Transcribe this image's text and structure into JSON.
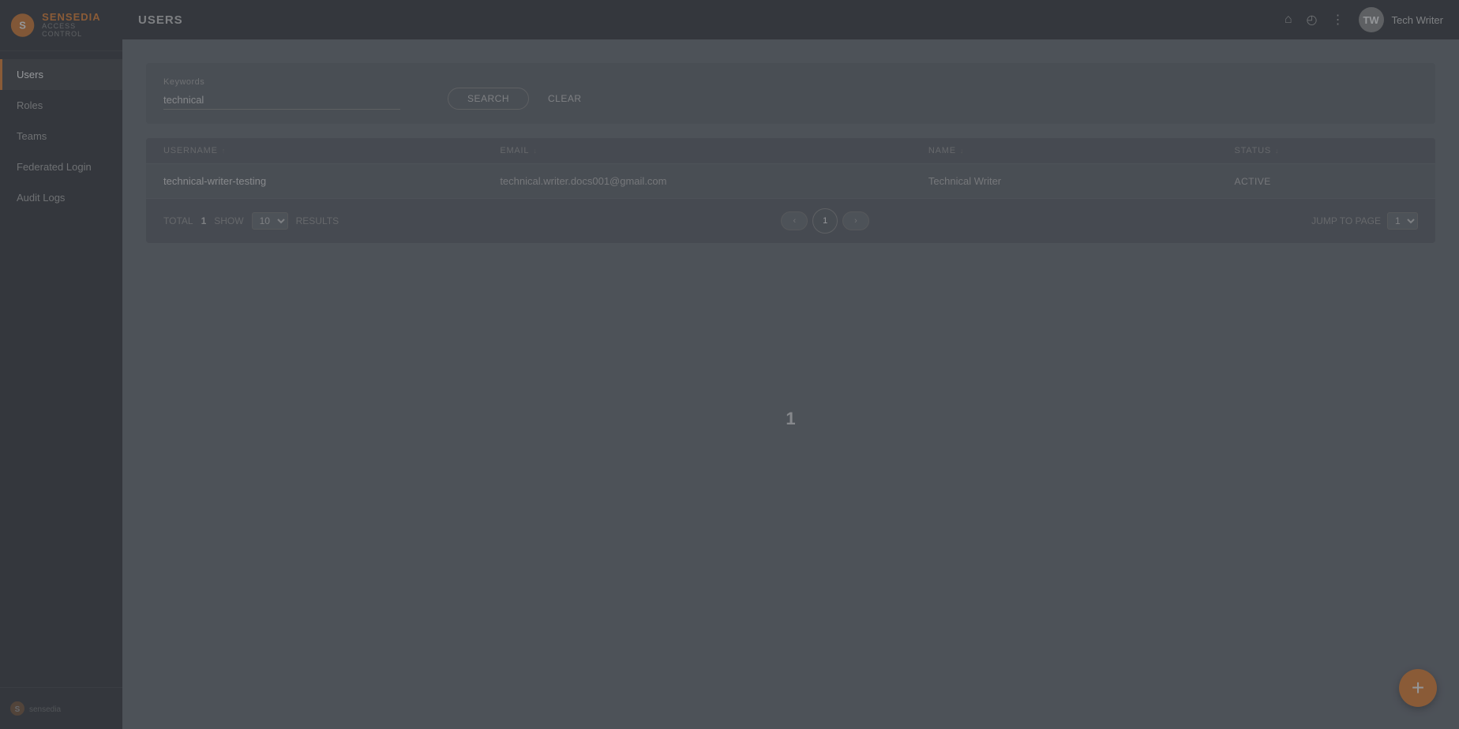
{
  "sidebar": {
    "logo_name": "sensedia",
    "logo_sub": "ACCESS CONTROL",
    "items": [
      {
        "label": "Users",
        "id": "users",
        "active": true
      },
      {
        "label": "Roles",
        "id": "roles",
        "active": false
      },
      {
        "label": "Teams",
        "id": "teams",
        "active": false
      },
      {
        "label": "Federated Login",
        "id": "federated-login",
        "active": false
      },
      {
        "label": "Audit Logs",
        "id": "audit-logs",
        "active": false
      }
    ],
    "bottom_logo": "sensedia"
  },
  "topbar": {
    "title": "USERS",
    "icons": [
      "home",
      "clock",
      "grid"
    ],
    "username": "Tech Writer"
  },
  "search": {
    "keywords_label": "Keywords",
    "keywords_value": "technical",
    "search_button": "SEARCH",
    "clear_button": "CLEAR"
  },
  "table": {
    "columns": [
      {
        "key": "username",
        "label": "USERNAME"
      },
      {
        "key": "email",
        "label": "EMAIL"
      },
      {
        "key": "name",
        "label": "NAME"
      },
      {
        "key": "status",
        "label": "STATUS"
      }
    ],
    "rows": [
      {
        "username": "technical-writer-testing",
        "email": "technical.writer.docs001@gmail.com",
        "name": "Technical Writer",
        "status": "ACTIVE"
      }
    ]
  },
  "pagination": {
    "total_label": "TOTAL",
    "total_value": "1",
    "show_label": "SHOW",
    "show_value": "10",
    "results_label": "RESULTS",
    "current_page": "1",
    "jump_label": "JUMP TO PAGE",
    "jump_value": "1",
    "prev_label": "‹",
    "next_label": "›"
  },
  "center_number": "1",
  "fab_label": "+"
}
